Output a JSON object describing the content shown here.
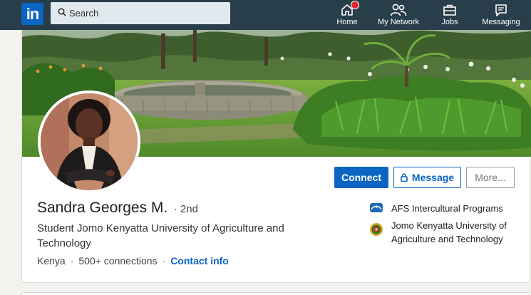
{
  "nav": {
    "logo_text": "in",
    "search_placeholder": "Search",
    "items": [
      {
        "label": "Home",
        "icon": "home-icon",
        "has_badge": true
      },
      {
        "label": "My Network",
        "icon": "network-icon"
      },
      {
        "label": "Jobs",
        "icon": "briefcase-icon"
      },
      {
        "label": "Messaging",
        "icon": "messaging-icon"
      }
    ],
    "colors": {
      "bar": "#283e4a",
      "logo": "#0a66c2",
      "badge": "#e0262b"
    }
  },
  "profile": {
    "name": "Sandra Georges M.",
    "degree": "· 2nd",
    "headline": "Student Jomo Kenyatta University of Agriculture and Technology",
    "location": "Kenya",
    "connections": "500+ connections",
    "contact_label": "Contact info",
    "actions": {
      "connect": "Connect",
      "message": "Message",
      "more": "More..."
    },
    "organizations": [
      {
        "name": "AFS Intercultural Programs",
        "icon": "afs-logo-icon"
      },
      {
        "name": "Jomo Kenyatta University of Agriculture and Technology",
        "icon": "university-crest-icon"
      }
    ],
    "colors": {
      "accent": "#0a66c2"
    }
  }
}
